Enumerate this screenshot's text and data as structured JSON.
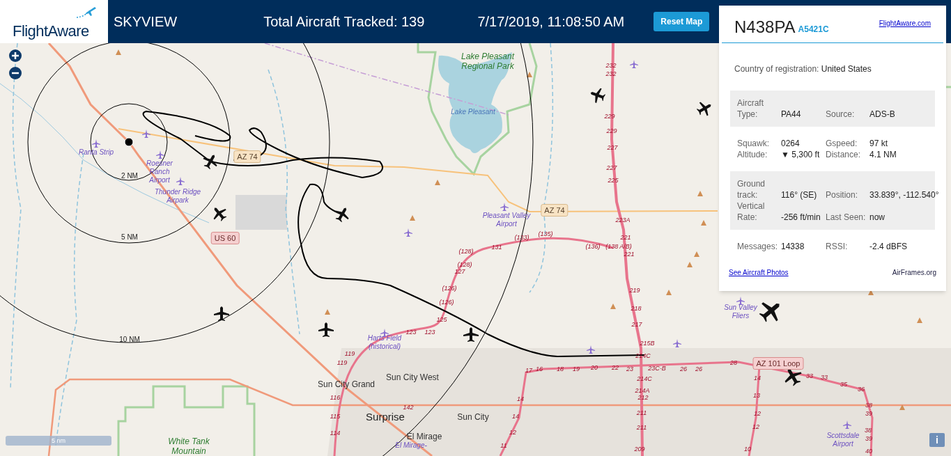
{
  "header": {
    "logo_text": "FlightAware",
    "title": "SKYVIEW",
    "tracked": "Total Aircraft Tracked: 139",
    "datetime": "7/17/2019, 11:08:50 AM",
    "reset_button": "Reset Map"
  },
  "panel": {
    "registration": "N438PA",
    "hex": "A5421C",
    "site_link": "FlightAware.com",
    "country_label": "Country of registration:",
    "country": "United States",
    "groups": [
      {
        "shaded": true,
        "rows": [
          [
            "Aircraft Type:",
            "PA44",
            "Source:",
            "ADS-B"
          ]
        ]
      },
      {
        "shaded": false,
        "rows": [
          [
            "Squawk:",
            "0264",
            "Gspeed:",
            "97 kt"
          ],
          [
            "Altitude:",
            "▼ 5,300 ft",
            "Distance:",
            "4.1 NM"
          ]
        ]
      },
      {
        "shaded": true,
        "rows": [
          [
            "Ground track:",
            "116° (SE)",
            "Position:",
            "33.839°, -112.540°"
          ],
          [
            "Vertical Rate:",
            "-256 ft/min",
            "Last Seen:",
            "now"
          ]
        ]
      },
      {
        "shaded": false,
        "rows": [
          [
            "Messages:",
            "14338",
            "RSSI:",
            "-2.4 dBFS"
          ]
        ]
      }
    ],
    "photos_link": "See Aircraft Photos",
    "airframes_link": "AirFrames.org"
  },
  "map": {
    "scale_bar": "5 nm",
    "info_button": "i",
    "labels": [
      {
        "kind": "park",
        "text": "Lake Pleasant Regional Park"
      },
      {
        "kind": "water",
        "text": "Lake Pleasant"
      },
      {
        "kind": "airport",
        "text": "Ranta Strip"
      },
      {
        "kind": "airport",
        "text": "Roesner Ranch Airport"
      },
      {
        "kind": "airport",
        "text": "Thunder Ridge Airpark"
      },
      {
        "kind": "airport",
        "text": "Pleasant Valley Airport"
      },
      {
        "kind": "airport",
        "text": "Harts Field (historical)"
      },
      {
        "kind": "airport",
        "text": "Sun Valley Fliers"
      },
      {
        "kind": "airport",
        "text": "Scottsdale Airport"
      },
      {
        "kind": "park",
        "text": "White Tank Mountain"
      },
      {
        "kind": "airport",
        "text": "El Mirage-"
      },
      {
        "kind": "town",
        "text": "Sun City Grand"
      },
      {
        "kind": "town",
        "text": "Sun City West"
      },
      {
        "kind": "city",
        "text": "Surprise"
      },
      {
        "kind": "town",
        "text": "Sun City"
      },
      {
        "kind": "town",
        "text": "El Mirage"
      },
      {
        "kind": "shield",
        "text": "AZ 74"
      },
      {
        "kind": "shield",
        "text": "AZ 74"
      },
      {
        "kind": "shield_red",
        "text": "US 60"
      },
      {
        "kind": "shield_red",
        "text": "AZ 101 Loop"
      },
      {
        "kind": "ring",
        "text": "2 NM"
      },
      {
        "kind": "ring",
        "text": "5 NM"
      },
      {
        "kind": "ring",
        "text": "10 NM"
      },
      {
        "kind": "exit",
        "text": "232"
      },
      {
        "kind": "exit",
        "text": "232"
      },
      {
        "kind": "exit",
        "text": "229"
      },
      {
        "kind": "exit",
        "text": "229"
      },
      {
        "kind": "exit",
        "text": "227"
      },
      {
        "kind": "exit",
        "text": "227"
      },
      {
        "kind": "exit",
        "text": "225"
      },
      {
        "kind": "exit",
        "text": "223A"
      },
      {
        "kind": "exit",
        "text": "221"
      },
      {
        "kind": "exit",
        "text": "221"
      },
      {
        "kind": "exit",
        "text": "(135)"
      },
      {
        "kind": "exit",
        "text": "(133)"
      },
      {
        "kind": "exit",
        "text": "131"
      },
      {
        "kind": "exit",
        "text": "(136)"
      },
      {
        "kind": "exit",
        "text": "(138 A/B)"
      },
      {
        "kind": "exit",
        "text": "(128)"
      },
      {
        "kind": "exit",
        "text": "(128)"
      },
      {
        "kind": "exit",
        "text": "127"
      },
      {
        "kind": "exit",
        "text": "(126)"
      },
      {
        "kind": "exit",
        "text": "(126)"
      },
      {
        "kind": "exit",
        "text": "125"
      },
      {
        "kind": "exit",
        "text": "123"
      },
      {
        "kind": "exit",
        "text": "123"
      },
      {
        "kind": "exit",
        "text": "119"
      },
      {
        "kind": "exit",
        "text": "119"
      },
      {
        "kind": "exit",
        "text": "116"
      },
      {
        "kind": "exit",
        "text": "115"
      },
      {
        "kind": "exit",
        "text": "114"
      },
      {
        "kind": "exit",
        "text": "142"
      },
      {
        "kind": "exit",
        "text": "219"
      },
      {
        "kind": "exit",
        "text": "218"
      },
      {
        "kind": "exit",
        "text": "217"
      },
      {
        "kind": "exit",
        "text": "215B"
      },
      {
        "kind": "exit",
        "text": "214C"
      },
      {
        "kind": "exit",
        "text": "23C-B"
      },
      {
        "kind": "exit",
        "text": "214C"
      },
      {
        "kind": "exit",
        "text": "214A"
      },
      {
        "kind": "exit",
        "text": "212"
      },
      {
        "kind": "exit",
        "text": "211"
      },
      {
        "kind": "exit",
        "text": "211"
      },
      {
        "kind": "exit",
        "text": "209"
      },
      {
        "kind": "exit",
        "text": "17"
      },
      {
        "kind": "exit",
        "text": "16"
      },
      {
        "kind": "exit",
        "text": "18"
      },
      {
        "kind": "exit",
        "text": "19"
      },
      {
        "kind": "exit",
        "text": "20"
      },
      {
        "kind": "exit",
        "text": "22"
      },
      {
        "kind": "exit",
        "text": "23"
      },
      {
        "kind": "exit",
        "text": "26"
      },
      {
        "kind": "exit",
        "text": "26"
      },
      {
        "kind": "exit",
        "text": "28"
      },
      {
        "kind": "exit",
        "text": "14"
      },
      {
        "kind": "exit",
        "text": "14"
      },
      {
        "kind": "exit",
        "text": "12"
      },
      {
        "kind": "exit",
        "text": "11"
      },
      {
        "kind": "exit",
        "text": "14"
      },
      {
        "kind": "exit",
        "text": "13"
      },
      {
        "kind": "exit",
        "text": "12"
      },
      {
        "kind": "exit",
        "text": "12"
      },
      {
        "kind": "exit",
        "text": "10"
      },
      {
        "kind": "exit",
        "text": "33"
      },
      {
        "kind": "exit",
        "text": "33"
      },
      {
        "kind": "exit",
        "text": "35"
      },
      {
        "kind": "exit",
        "text": "36"
      },
      {
        "kind": "exit",
        "text": "38"
      },
      {
        "kind": "exit",
        "text": "39"
      },
      {
        "kind": "exit",
        "text": "38"
      },
      {
        "kind": "exit",
        "text": "39"
      },
      {
        "kind": "exit",
        "text": "40"
      }
    ]
  }
}
